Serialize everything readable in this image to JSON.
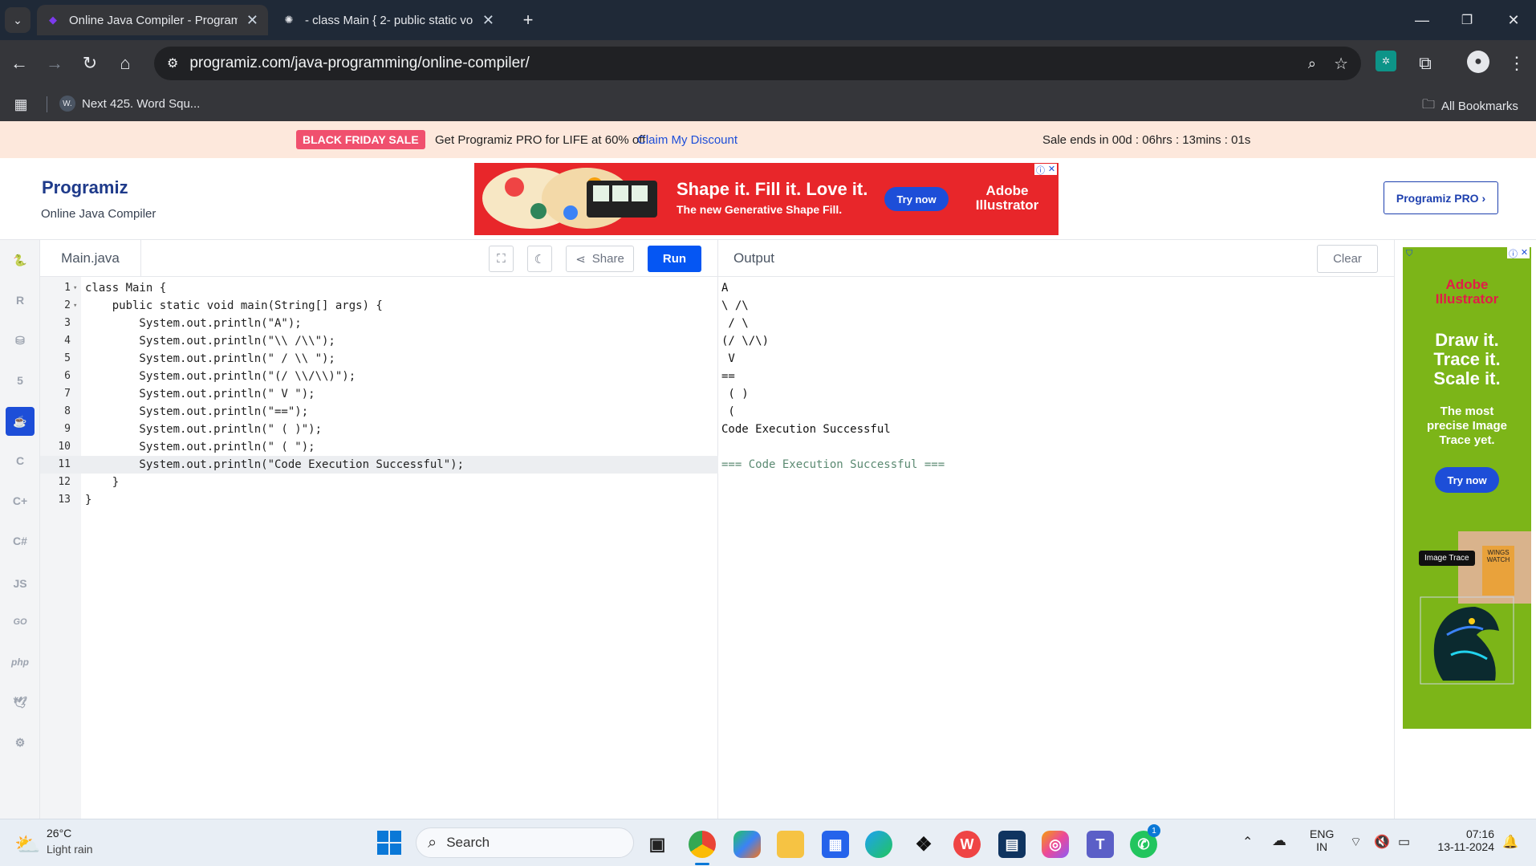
{
  "browser": {
    "tabs": [
      {
        "title": "Online Java Compiler - Programiz"
      },
      {
        "title": "- class Main { 2- public static vo"
      }
    ],
    "new_tab": "+",
    "url": "programiz.com/java-programming/online-compiler/",
    "bookmark": "Next 425. Word Squ...",
    "bookmark_badge": "W.",
    "all_bookmarks": "All Bookmarks"
  },
  "sale": {
    "badge": "BLACK FRIDAY SALE",
    "text": "Get Programiz PRO for LIFE at 60% off!",
    "link": "Claim My Discount",
    "countdown": "Sale ends in 00d : 06hrs : 13mins : 01s"
  },
  "header": {
    "logo": "Programiz",
    "subtitle": "Online Java Compiler",
    "pro_button": "Programiz PRO ›"
  },
  "ad_banner": {
    "headline": "Shape it. Fill it. Love it.",
    "sub": "The new Generative Shape Fill.",
    "cta": "Try now",
    "brand_line1": "Adobe",
    "brand_line2": "Illustrator"
  },
  "sidebar": {
    "items": [
      "python",
      "r",
      "sql",
      "html",
      "java",
      "c",
      "cpp",
      "csharp",
      "JS",
      "GO",
      "php",
      "swift",
      "rust"
    ]
  },
  "editor": {
    "filename": "Main.java",
    "share": "Share",
    "run": "Run",
    "current_line": 11,
    "lines": [
      {
        "n": "1",
        "fold": "▾",
        "text": "class Main {"
      },
      {
        "n": "2",
        "fold": "▾",
        "text": "    public static void main(String[] args) {"
      },
      {
        "n": "3",
        "fold": "",
        "text": "        System.out.println(\"A\");"
      },
      {
        "n": "4",
        "fold": "",
        "text": "        System.out.println(\"\\\\ /\\\\\");"
      },
      {
        "n": "5",
        "fold": "",
        "text": "        System.out.println(\" / \\\\ \");"
      },
      {
        "n": "6",
        "fold": "",
        "text": "        System.out.println(\"(/ \\\\/\\\\)\");"
      },
      {
        "n": "7",
        "fold": "",
        "text": "        System.out.println(\" V \");"
      },
      {
        "n": "8",
        "fold": "",
        "text": "        System.out.println(\"==\");"
      },
      {
        "n": "9",
        "fold": "",
        "text": "        System.out.println(\" ( )\");"
      },
      {
        "n": "10",
        "fold": "",
        "text": "        System.out.println(\" ( \");"
      },
      {
        "n": "11",
        "fold": "",
        "text": "        System.out.println(\"Code Execution Successful\");"
      },
      {
        "n": "12",
        "fold": "",
        "text": "    }"
      },
      {
        "n": "13",
        "fold": "",
        "text": "}"
      }
    ]
  },
  "output": {
    "title": "Output",
    "clear": "Clear",
    "lines": [
      "A",
      "\\ /\\",
      " / \\",
      "(/ \\/\\)",
      " V",
      "==",
      " ( )",
      " (",
      "Code Execution Successful",
      "",
      "=== Code Execution Successful ==="
    ]
  },
  "side_ad": {
    "brand_line1": "Adobe",
    "brand_line2": "Illustrator",
    "headline": [
      "Draw it.",
      "Trace it.",
      "Scale it."
    ],
    "sub": "The most precise Image Trace yet.",
    "cta": "Try now",
    "tooltip": "Image Trace",
    "book": "WINGS WATCH"
  },
  "taskbar": {
    "weather_temp": "26°C",
    "weather_desc": "Light rain",
    "search": "Search",
    "lang1": "ENG",
    "lang2": "IN",
    "time": "07:16",
    "date": "13-11-2024",
    "whatsapp_badge": "1"
  },
  "colors": {
    "run_button": "#0556f3",
    "java_active": "#1d4ed8",
    "sale_badge": "#f0506e",
    "ad_red": "#e8262a",
    "ad_green": "#7cb518"
  }
}
